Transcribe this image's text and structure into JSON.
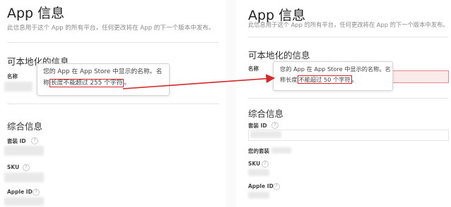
{
  "left": {
    "app_title": "App 信息",
    "subtitle": "此信息用于这个 App 的所有平台，任何更改将在 App 的下一个版本中发布。",
    "localizable_title": "可本地化的信息",
    "name_label": "名称",
    "tooltip_line1": "您的 App 在 App Store 中显示的名称。名",
    "tooltip_line2_prefix": "称",
    "tooltip_highlight": "长度不能超过 255 个字符",
    "tooltip_line2_suffix": "。",
    "general_title": "综合信息",
    "bundle_id_label": "套装 ID",
    "sku_label": "SKU",
    "apple_id_label": "Apple ID"
  },
  "right": {
    "app_title": "App 信息",
    "subtitle": "此信息用于这个 App 的所有平台，任何更改将在 App 的下一个版本中发布。",
    "localizable_title": "可本地化的信息",
    "name_label": "名称",
    "tooltip_line1": "您的 App 在 App Store 中显示的名称。名",
    "tooltip_line2_prefix": "称长度",
    "tooltip_highlight": "不能超过 50 个字符",
    "tooltip_line2_suffix": "。",
    "general_title": "综合信息",
    "bundle_id_label": "套装 ID",
    "your_bundle_label": "您的套装",
    "sku_label": "SKU",
    "apple_id_label": "Apple ID"
  },
  "help_glyph": "?",
  "colors": {
    "highlight": "#d4282a",
    "arrow": "#d4282a",
    "error_field": "#fbeaea"
  }
}
